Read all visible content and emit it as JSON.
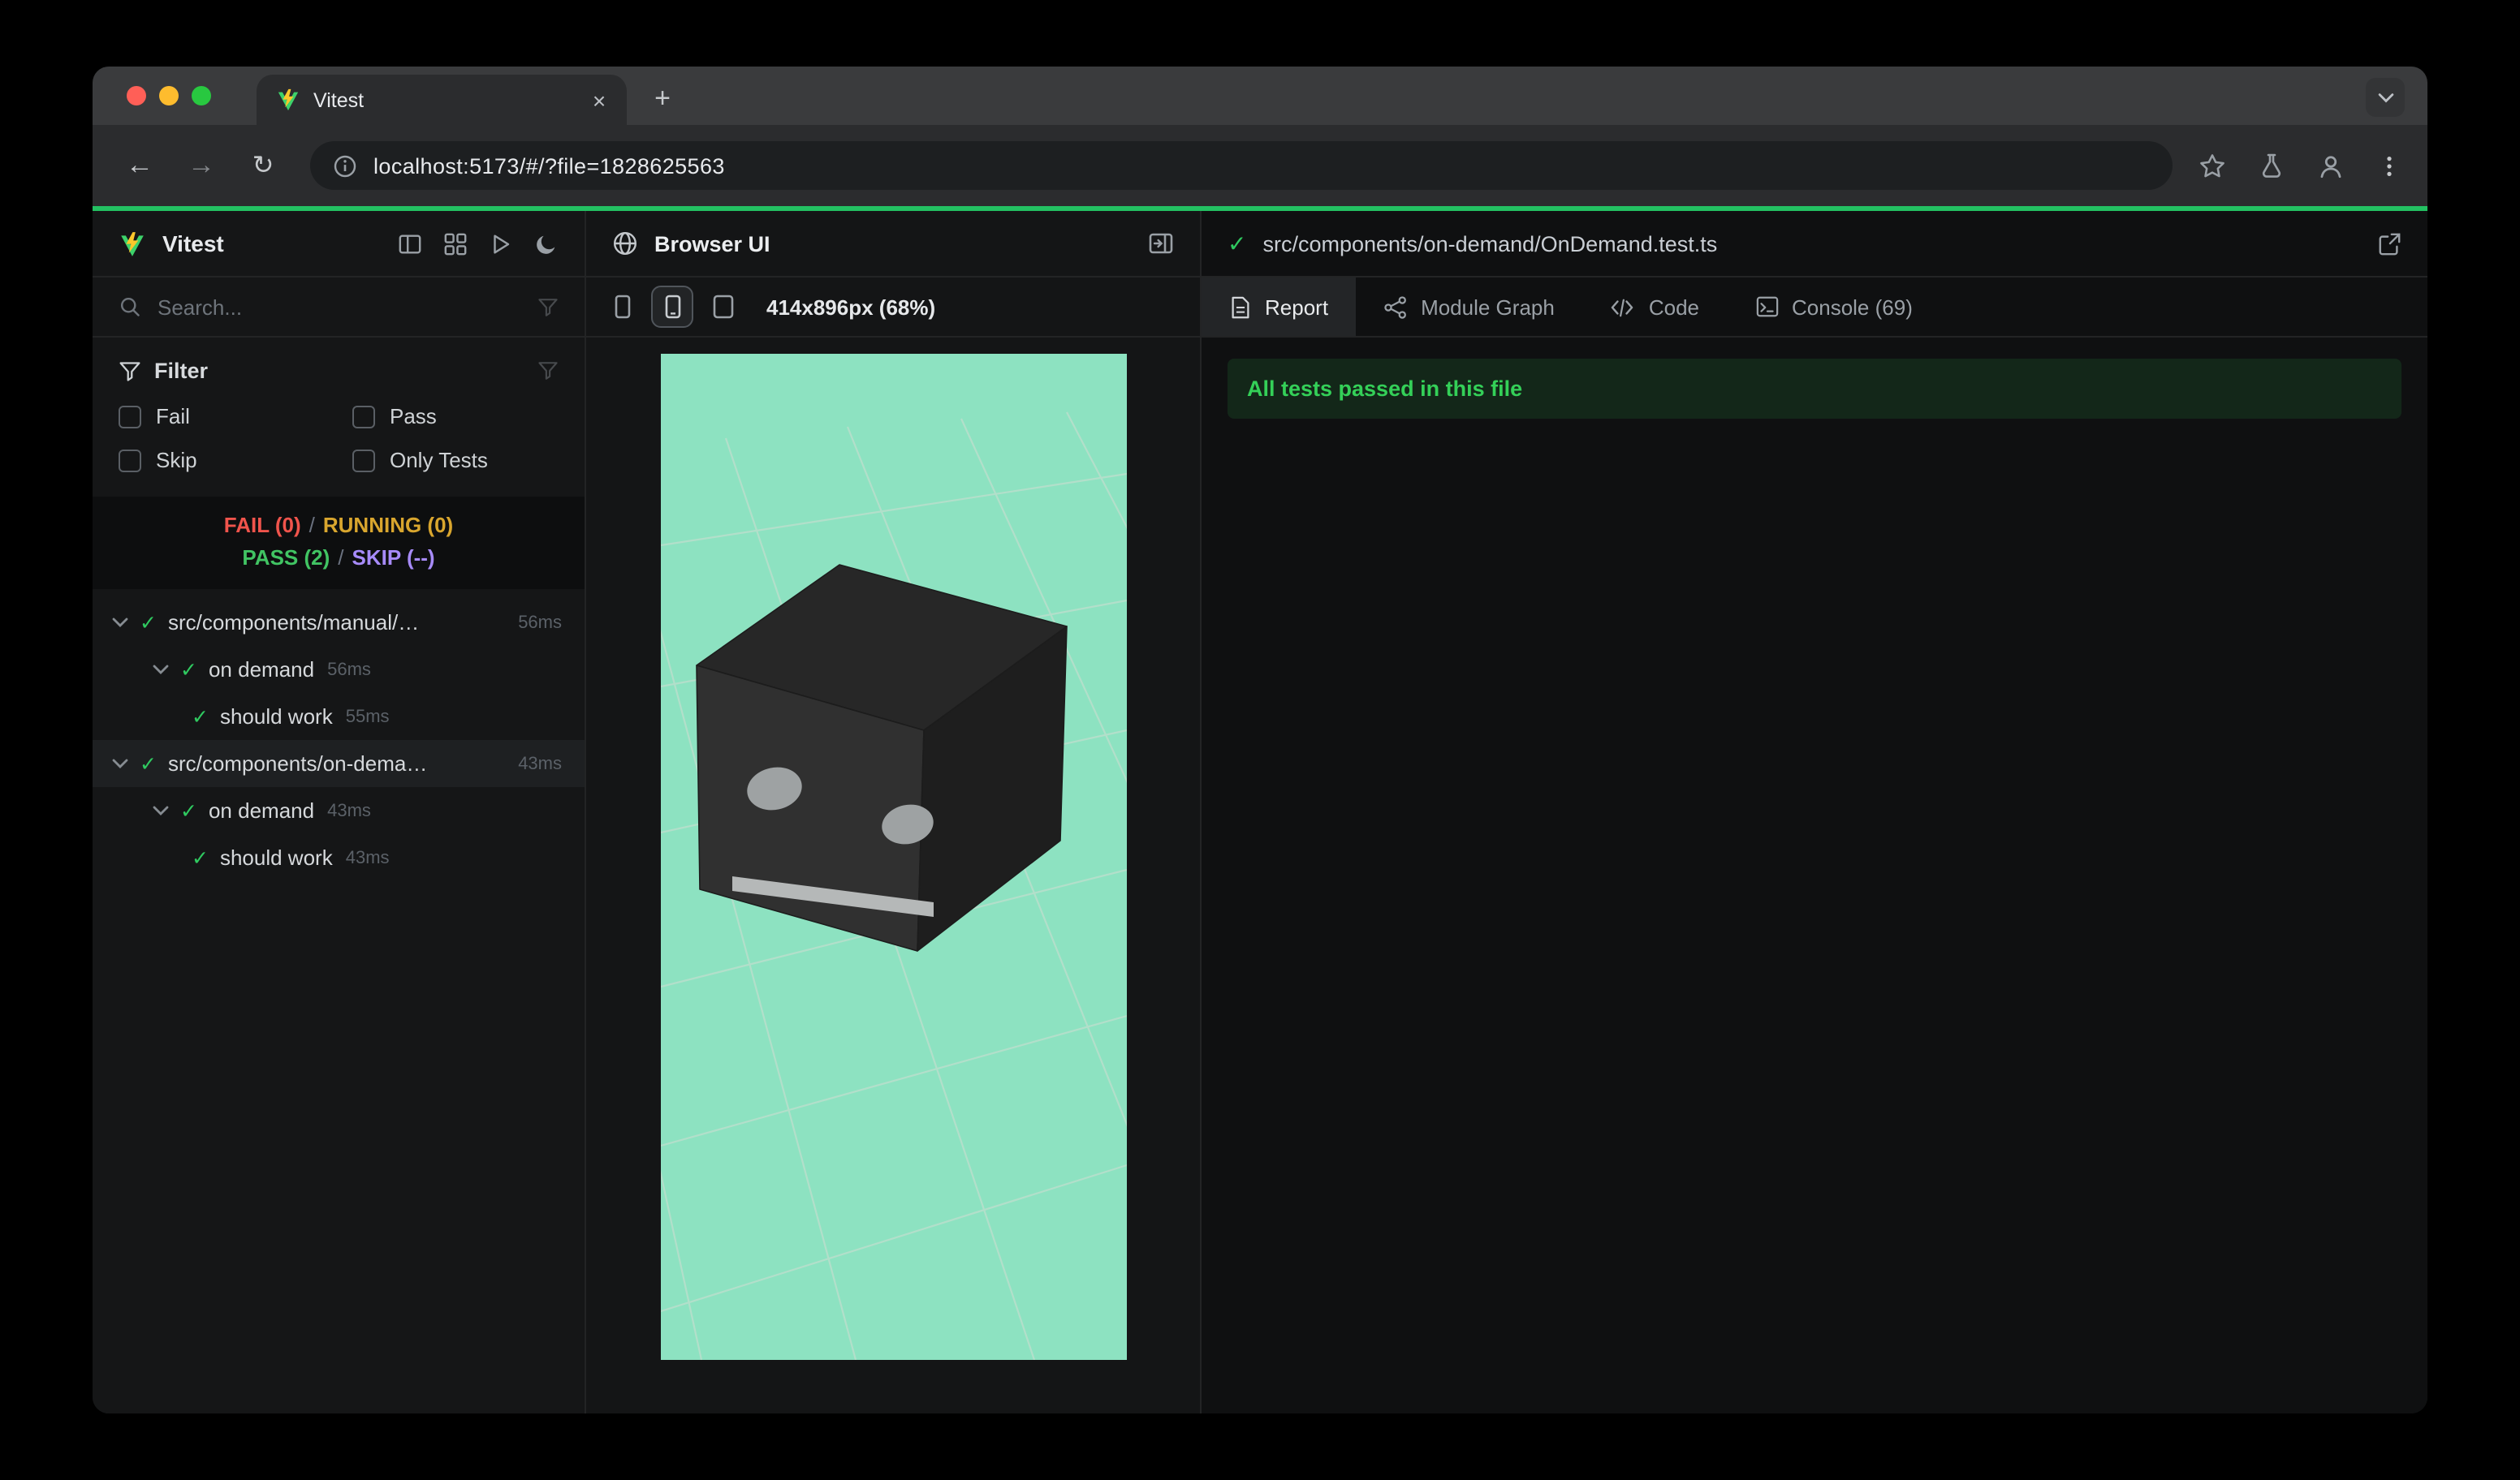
{
  "chrome": {
    "tab_title": "Vitest",
    "url": "localhost:5173/#/?file=1828625563"
  },
  "sidebar": {
    "app_name": "Vitest",
    "search_placeholder": "Search...",
    "filter_title": "Filter",
    "filters": {
      "fail": "Fail",
      "pass": "Pass",
      "skip": "Skip",
      "only": "Only Tests"
    },
    "summary": {
      "fail": "FAIL (0)",
      "running": "RUNNING (0)",
      "pass": "PASS (2)",
      "skip": "SKIP (--)",
      "sep": "/"
    },
    "tree": [
      {
        "label": "src/components/manual/…",
        "time": "56ms"
      },
      {
        "label": "on demand",
        "time": "56ms"
      },
      {
        "label": "should work",
        "time": "55ms"
      },
      {
        "label": "src/components/on-dema…",
        "time": "43ms"
      },
      {
        "label": "on demand",
        "time": "43ms"
      },
      {
        "label": "should work",
        "time": "43ms"
      }
    ]
  },
  "browser_panel": {
    "title": "Browser UI",
    "viewport_label": "414x896px (68%)"
  },
  "report_panel": {
    "file_path": "src/components/on-demand/OnDemand.test.ts",
    "tabs": {
      "report": "Report",
      "module_graph": "Module Graph",
      "code": "Code",
      "console": "Console (69)"
    },
    "banner": "All tests passed in this file"
  },
  "colors": {
    "accent_green": "#23c162",
    "canvas_mint": "#8de2c1"
  }
}
